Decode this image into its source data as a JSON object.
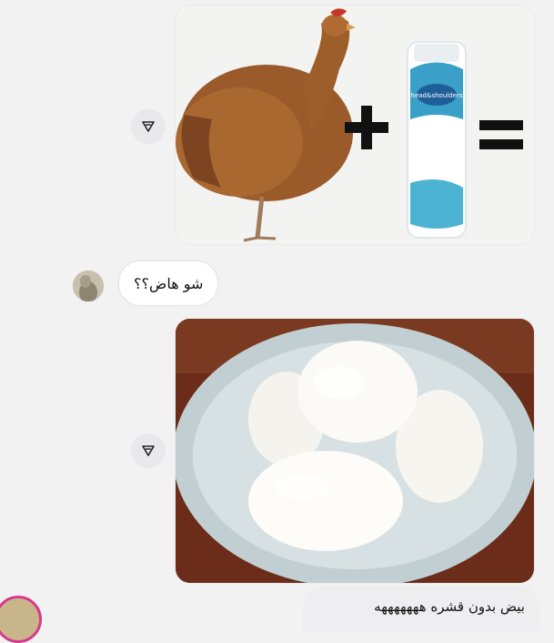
{
  "conversation": {
    "messages": [
      {
        "direction": "outgoing",
        "type": "image",
        "description_icon": "chicken-plus-shampoo-equals"
      },
      {
        "direction": "incoming",
        "type": "text",
        "text": "شو هاض؟؟"
      },
      {
        "direction": "outgoing",
        "type": "image",
        "description_icon": "boiled-eggs-bowl"
      },
      {
        "direction": "outgoing",
        "type": "text",
        "text": "بيض بدون قشره هههههههه"
      }
    ]
  },
  "shampoo_label": {
    "brand": "head&shoulders"
  },
  "icons": {
    "share": "share-arrow-icon"
  },
  "colors": {
    "background": "#f2f2f3",
    "bubble_in": "#ffffff",
    "bubble_out": "#eeeef0",
    "story_ring": "#d63a8c"
  }
}
